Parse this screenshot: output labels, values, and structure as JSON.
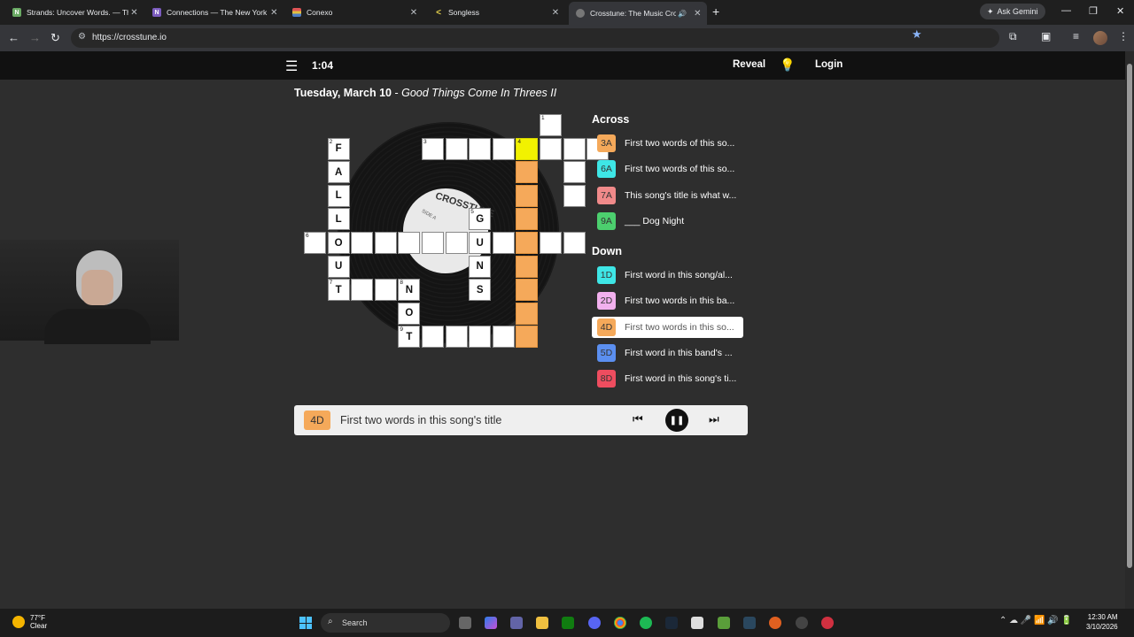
{
  "browser": {
    "tabs": [
      {
        "title": "Strands: Uncover Words. — The",
        "icon_color": "#6aaa64",
        "icon_letter": "N"
      },
      {
        "title": "Connections — The New York T",
        "icon_color": "#7c5cbf",
        "icon_letter": "N"
      },
      {
        "title": "Conexo",
        "icon_color": "#4d7cc4",
        "icon_letter": ""
      },
      {
        "title": "Songless",
        "icon_color": "#e8d44d",
        "icon_letter": "<"
      },
      {
        "title": "Crosstune: The Music Cros",
        "icon_color": "#777777",
        "icon_letter": ""
      }
    ],
    "gemini_label": "Ask Gemini",
    "url": "https://crosstune.io"
  },
  "app": {
    "timer": "1:04",
    "reveal_label": "Reveal",
    "login_label": "Login",
    "date": "Tuesday, March 10",
    "puzzle_title": "Good Things Come In Threes II",
    "record_label": "CROSSTUNE",
    "record_side": "SIDE A"
  },
  "grid": {
    "cells": [
      {
        "r": 0,
        "c": 10,
        "n": "1",
        "l": "",
        "s": ""
      },
      {
        "r": 1,
        "c": 1,
        "n": "2",
        "l": "F",
        "s": ""
      },
      {
        "r": 1,
        "c": 5,
        "n": "3",
        "l": "",
        "s": ""
      },
      {
        "r": 1,
        "c": 6,
        "n": "",
        "l": "",
        "s": ""
      },
      {
        "r": 1,
        "c": 7,
        "n": "",
        "l": "",
        "s": ""
      },
      {
        "r": 1,
        "c": 8,
        "n": "",
        "l": "",
        "s": ""
      },
      {
        "r": 1,
        "c": 9,
        "n": "4",
        "l": "",
        "s": "sel"
      },
      {
        "r": 1,
        "c": 10,
        "n": "",
        "l": "",
        "s": ""
      },
      {
        "r": 1,
        "c": 11,
        "n": "",
        "l": "",
        "s": ""
      },
      {
        "r": 1,
        "c": 12,
        "n": "",
        "l": "",
        "s": ""
      },
      {
        "r": 2,
        "c": 1,
        "n": "",
        "l": "A",
        "s": ""
      },
      {
        "r": 2,
        "c": 9,
        "n": "",
        "l": "",
        "s": "hl"
      },
      {
        "r": 2,
        "c": 11,
        "n": "",
        "l": "",
        "s": ""
      },
      {
        "r": 3,
        "c": 1,
        "n": "",
        "l": "L",
        "s": ""
      },
      {
        "r": 3,
        "c": 9,
        "n": "",
        "l": "",
        "s": "hl"
      },
      {
        "r": 3,
        "c": 11,
        "n": "",
        "l": "",
        "s": ""
      },
      {
        "r": 4,
        "c": 1,
        "n": "",
        "l": "L",
        "s": ""
      },
      {
        "r": 4,
        "c": 7,
        "n": "5",
        "l": "G",
        "s": ""
      },
      {
        "r": 4,
        "c": 9,
        "n": "",
        "l": "",
        "s": "hl"
      },
      {
        "r": 5,
        "c": 0,
        "n": "6",
        "l": "",
        "s": ""
      },
      {
        "r": 5,
        "c": 1,
        "n": "",
        "l": "O",
        "s": ""
      },
      {
        "r": 5,
        "c": 2,
        "n": "",
        "l": "",
        "s": ""
      },
      {
        "r": 5,
        "c": 3,
        "n": "",
        "l": "",
        "s": ""
      },
      {
        "r": 5,
        "c": 4,
        "n": "",
        "l": "",
        "s": ""
      },
      {
        "r": 5,
        "c": 5,
        "n": "",
        "l": "",
        "s": ""
      },
      {
        "r": 5,
        "c": 6,
        "n": "",
        "l": "",
        "s": ""
      },
      {
        "r": 5,
        "c": 7,
        "n": "",
        "l": "U",
        "s": ""
      },
      {
        "r": 5,
        "c": 8,
        "n": "",
        "l": "",
        "s": ""
      },
      {
        "r": 5,
        "c": 9,
        "n": "",
        "l": "",
        "s": "hl"
      },
      {
        "r": 5,
        "c": 10,
        "n": "",
        "l": "",
        "s": ""
      },
      {
        "r": 5,
        "c": 11,
        "n": "",
        "l": "",
        "s": ""
      },
      {
        "r": 6,
        "c": 1,
        "n": "",
        "l": "U",
        "s": ""
      },
      {
        "r": 6,
        "c": 7,
        "n": "",
        "l": "N",
        "s": ""
      },
      {
        "r": 6,
        "c": 9,
        "n": "",
        "l": "",
        "s": "hl"
      },
      {
        "r": 7,
        "c": 1,
        "n": "7",
        "l": "T",
        "s": ""
      },
      {
        "r": 7,
        "c": 2,
        "n": "",
        "l": "",
        "s": ""
      },
      {
        "r": 7,
        "c": 3,
        "n": "",
        "l": "",
        "s": ""
      },
      {
        "r": 7,
        "c": 4,
        "n": "8",
        "l": "N",
        "s": ""
      },
      {
        "r": 7,
        "c": 7,
        "n": "",
        "l": "S",
        "s": ""
      },
      {
        "r": 7,
        "c": 9,
        "n": "",
        "l": "",
        "s": "hl"
      },
      {
        "r": 8,
        "c": 4,
        "n": "",
        "l": "O",
        "s": ""
      },
      {
        "r": 8,
        "c": 9,
        "n": "",
        "l": "",
        "s": "hl"
      },
      {
        "r": 9,
        "c": 4,
        "n": "9",
        "l": "T",
        "s": ""
      },
      {
        "r": 9,
        "c": 5,
        "n": "",
        "l": "",
        "s": ""
      },
      {
        "r": 9,
        "c": 6,
        "n": "",
        "l": "",
        "s": ""
      },
      {
        "r": 9,
        "c": 7,
        "n": "",
        "l": "",
        "s": ""
      },
      {
        "r": 9,
        "c": 8,
        "n": "",
        "l": "",
        "s": ""
      },
      {
        "r": 9,
        "c": 9,
        "n": "",
        "l": "",
        "s": "hl"
      }
    ]
  },
  "clues": {
    "across_heading": "Across",
    "down_heading": "Down",
    "across": [
      {
        "id": "3A",
        "text": "First two words of this so...",
        "color": "#f5a95a"
      },
      {
        "id": "6A",
        "text": "First two words of this so...",
        "color": "#3ee6e6"
      },
      {
        "id": "7A",
        "text": "This song's title is what w...",
        "color": "#f08a8a"
      },
      {
        "id": "9A",
        "text": "___ Dog Night",
        "color": "#4ccf6e"
      }
    ],
    "down": [
      {
        "id": "1D",
        "text": "First word in this song/al...",
        "color": "#3ee6e6"
      },
      {
        "id": "2D",
        "text": "First two words in this ba...",
        "color": "#f2b0ee"
      },
      {
        "id": "4D",
        "text": "First two words in this so...",
        "color": "#f5a95a"
      },
      {
        "id": "5D",
        "text": "First word in this band's ...",
        "color": "#5b8ff0"
      },
      {
        "id": "8D",
        "text": "First word in this song's ti...",
        "color": "#ee4d5f"
      }
    ],
    "selected": "4D"
  },
  "player": {
    "clue_id": "4D",
    "clue_text": "First two words in this song's title"
  },
  "taskbar": {
    "weather_temp": "77°F",
    "weather_desc": "Clear",
    "search_label": "Search",
    "time": "12:30 AM",
    "date": "3/10/2026"
  }
}
